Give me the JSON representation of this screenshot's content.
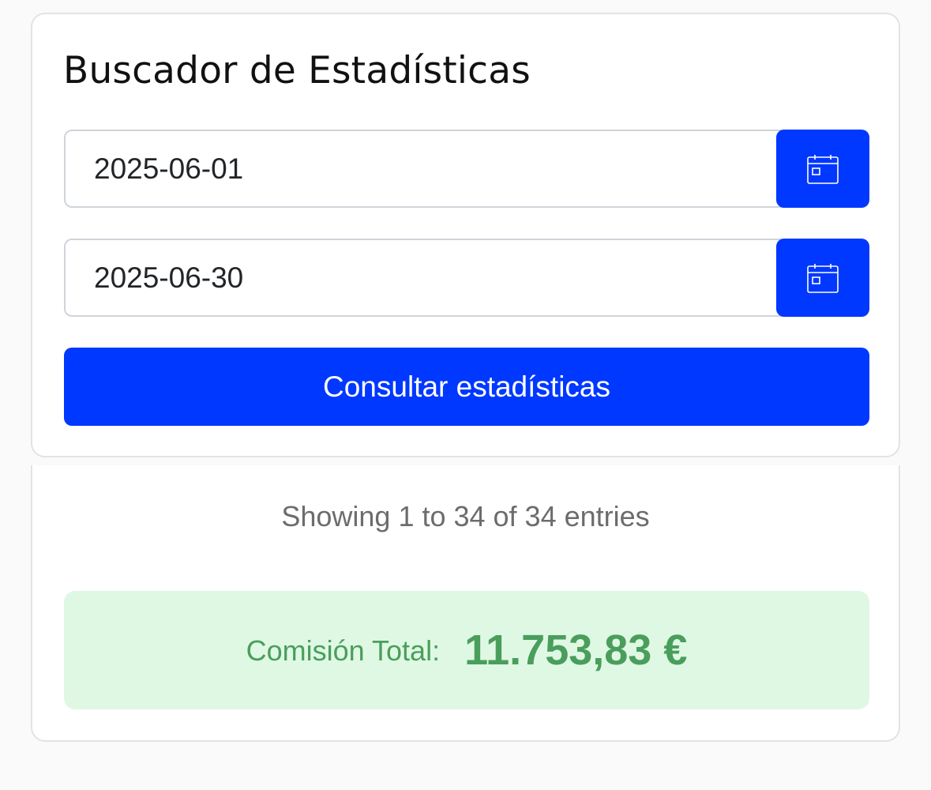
{
  "search": {
    "title": "Buscador de Estadísticas",
    "start_date": "2025-06-01",
    "end_date": "2025-06-30",
    "calendar_icon": "calendar-icon",
    "submit_label": "Consultar estadísticas"
  },
  "results": {
    "entries_info": "Showing 1 to 34 of 34 entries",
    "total_label": "Comisión Total:",
    "total_value": "11.753,83 €"
  },
  "colors": {
    "accent": "#0038ff",
    "success_text": "#4a9e5c",
    "success_bg": "#dff8e4"
  }
}
